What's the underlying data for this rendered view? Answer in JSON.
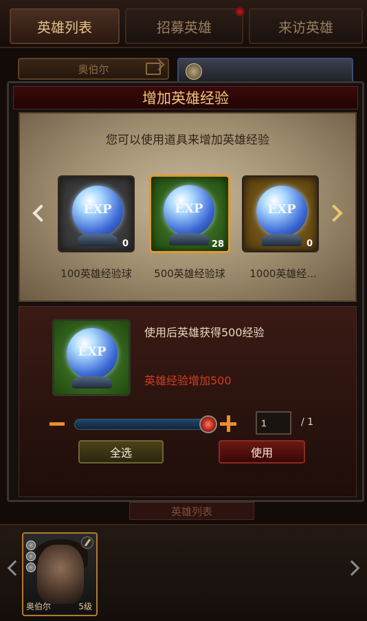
{
  "tabs": {
    "hero_list": "英雄列表",
    "recruit": "招募英雄",
    "visit": "来访英雄"
  },
  "background": {
    "hero_name": "奥伯尔",
    "bottom_label": "英雄列表",
    "hero_card": {
      "name": "奥伯尔",
      "level": "5级"
    }
  },
  "modal": {
    "title": "增加英雄经验",
    "instruction": "您可以使用道具来增加英雄经验",
    "items": [
      {
        "name": "100英雄经验球",
        "count": "0",
        "label": "EXP"
      },
      {
        "name": "500英雄经验球",
        "count": "28",
        "label": "EXP"
      },
      {
        "name": "1000英雄经...",
        "count": "0",
        "label": "EXP"
      }
    ],
    "detail": {
      "label": "EXP",
      "description": "使用后英雄获得500经验",
      "gain": "英雄经验增加500",
      "quantity": "1",
      "max": "/ 1",
      "slider_fraction": 1.0
    },
    "buttons": {
      "select_all": "全选",
      "use": "使用"
    }
  },
  "colors": {
    "accent": "#f1c67a",
    "highlight": "#e19b2b",
    "danger": "#d43b24"
  }
}
